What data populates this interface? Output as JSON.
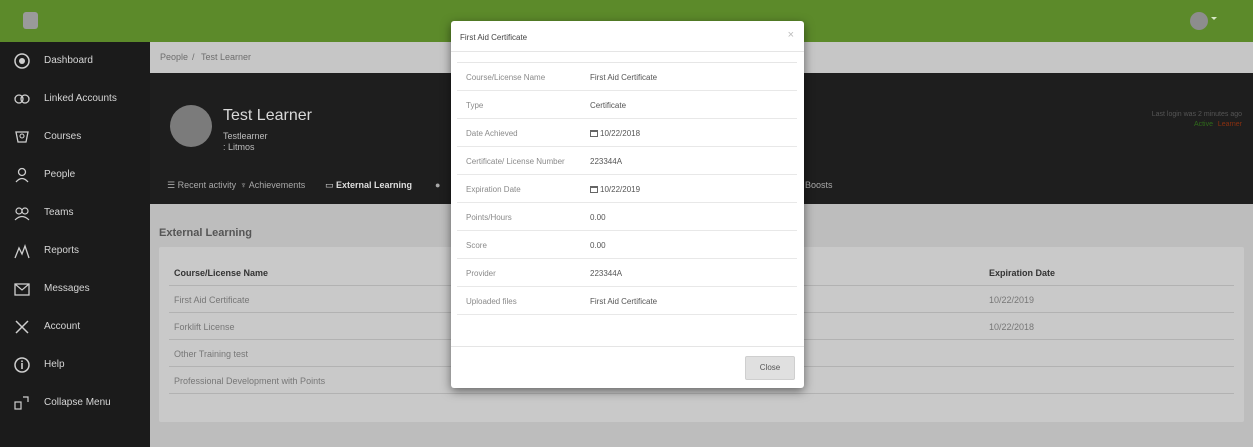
{
  "sidebar": {
    "items": [
      {
        "label": "Dashboard",
        "icon": "info-circle-icon"
      },
      {
        "label": "Linked Accounts",
        "icon": "link-icon"
      },
      {
        "label": "Courses",
        "icon": "courses-icon"
      },
      {
        "label": "People",
        "icon": "person-icon"
      },
      {
        "label": "Teams",
        "icon": "teams-icon"
      },
      {
        "label": "Reports",
        "icon": "reports-icon"
      },
      {
        "label": "Messages",
        "icon": "envelope-icon"
      },
      {
        "label": "Account",
        "icon": "tools-icon"
      },
      {
        "label": "Help",
        "icon": "help-icon"
      },
      {
        "label": "Collapse Menu",
        "icon": "collapse-icon"
      }
    ]
  },
  "breadcrumb": {
    "root": "People",
    "sep": "/",
    "current": "Test Learner"
  },
  "profile": {
    "name": "Test Learner",
    "username": "Testlearner",
    "org": ": Litmos",
    "last_login": "Last login was 2 minutes ago",
    "status": "Active",
    "role": "Learner"
  },
  "tabs": [
    {
      "label": "Recent activity",
      "icon": "list-icon"
    },
    {
      "label": "Achievements",
      "icon": "trophy-icon"
    },
    {
      "label": "External Learning",
      "icon": "laptop-icon"
    },
    {
      "label": "",
      "icon": "dot-icon"
    },
    {
      "label": "Boosts",
      "icon": "boost-icon"
    }
  ],
  "section": {
    "title": "External Learning"
  },
  "table": {
    "headers": [
      "Course/License Name",
      "Expiration Date"
    ],
    "rows": [
      [
        "First Aid Certificate",
        "10/22/2019"
      ],
      [
        "Forklift License",
        "10/22/2018"
      ],
      [
        "Other Training test",
        ""
      ],
      [
        "Professional Development with Points",
        ""
      ]
    ]
  },
  "modal": {
    "title": "First Aid Certificate",
    "close_x": "×",
    "close_label": "Close",
    "fields": [
      {
        "key": "Course/License Name",
        "value": "First Aid Certificate",
        "cal": false
      },
      {
        "key": "Type",
        "value": "Certificate",
        "cal": false
      },
      {
        "key": "Date Achieved",
        "value": "10/22/2018",
        "cal": true
      },
      {
        "key": "Certificate/ License Number",
        "value": "223344A",
        "cal": false
      },
      {
        "key": "Expiration Date",
        "value": "10/22/2019",
        "cal": true
      },
      {
        "key": "Points/Hours",
        "value": "0.00",
        "cal": false
      },
      {
        "key": "Score",
        "value": "0.00",
        "cal": false
      },
      {
        "key": "Provider",
        "value": "223344A",
        "cal": false
      },
      {
        "key": "Uploaded files",
        "value": "First Aid Certificate",
        "cal": false
      }
    ]
  },
  "colors": {
    "topbar": "#5c8a2a",
    "sidebar": "#1b1b1b",
    "header": "#1e1e1e"
  }
}
